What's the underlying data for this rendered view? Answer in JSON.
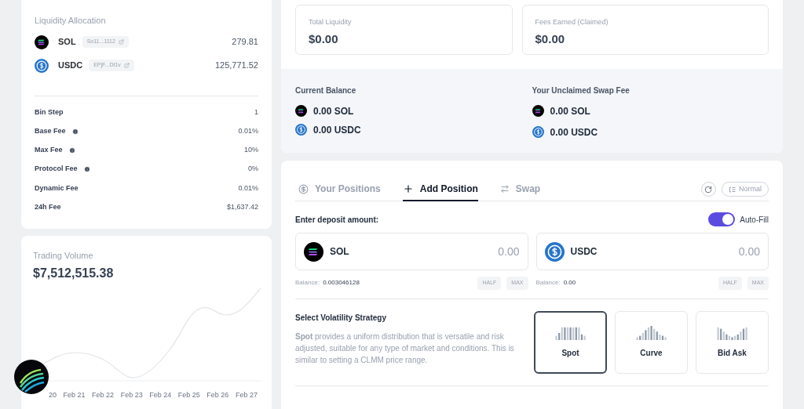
{
  "liquidity_allocation": {
    "title": "Liquidity Allocation",
    "tokens": [
      {
        "kind": "sol",
        "symbol": "SOL",
        "address": "So11...1112",
        "amount": "279.81"
      },
      {
        "kind": "usdc",
        "symbol": "USDC",
        "address": "EPjF...Dt1v",
        "amount": "125,771.52"
      }
    ],
    "params": [
      {
        "label": "Bin Step",
        "info": false,
        "value": "1"
      },
      {
        "label": "Base Fee",
        "info": true,
        "value": "0.01%"
      },
      {
        "label": "Max Fee",
        "info": true,
        "value": "10%"
      },
      {
        "label": "Protocol Fee",
        "info": true,
        "value": "0%"
      },
      {
        "label": "Dynamic Fee",
        "info": false,
        "value": "0.01%"
      },
      {
        "label": "24h Fee",
        "info": false,
        "value": "$1,637.42"
      }
    ]
  },
  "trading_volume": {
    "title": "Trading Volume",
    "value": "$7,512,515.38",
    "x_labels": [
      "20",
      "Feb 21",
      "Feb 22",
      "Feb 23",
      "Feb 24",
      "Feb 25",
      "Feb 26",
      "Feb 27"
    ]
  },
  "stats": [
    {
      "label": "Total Liquidity",
      "value": "$0.00"
    },
    {
      "label": "Fees Earned (Claimed)",
      "value": "$0.00"
    }
  ],
  "balances": [
    {
      "title": "Current Balance",
      "items": [
        {
          "kind": "sol",
          "text": "0.00 SOL"
        },
        {
          "kind": "usdc",
          "text": "0.00 USDC"
        }
      ]
    },
    {
      "title": "Your Unclaimed Swap Fee",
      "items": [
        {
          "kind": "sol",
          "text": "0.00 SOL"
        },
        {
          "kind": "usdc",
          "text": "0.00 USDC"
        }
      ]
    }
  ],
  "tabs": [
    {
      "kind": "positions",
      "label": "Your Positions",
      "selected": false
    },
    {
      "kind": "add",
      "label": "Add Position",
      "selected": true
    },
    {
      "kind": "swap",
      "label": "Swap",
      "selected": false
    }
  ],
  "mode_button": "Normal",
  "deposit": {
    "label": "Enter deposit amount:",
    "auto_fill": {
      "label": "Auto-Fill",
      "on": true
    },
    "inputs": [
      {
        "kind": "sol",
        "symbol": "SOL",
        "placeholder": "0.00",
        "balance_label": "Balance:",
        "balance": "0.003046128",
        "half": "HALF",
        "max": "MAX"
      },
      {
        "kind": "usdc",
        "symbol": "USDC",
        "placeholder": "0.00",
        "balance_label": "Balance:",
        "balance": "0.00",
        "half": "HALF",
        "max": "MAX"
      }
    ]
  },
  "strategy": {
    "title": "Select Volatility Strategy",
    "description": "**Spot** provides a uniform distribution that is versatile and risk adjusted, suitable for any type of market and conditions. This is similar to setting a CLMM price range.",
    "options": [
      {
        "kind": "spot",
        "label": "Spot",
        "selected": true
      },
      {
        "kind": "curve",
        "label": "Curve",
        "selected": false
      },
      {
        "kind": "bidask",
        "label": "Bid Ask",
        "selected": false
      }
    ]
  }
}
